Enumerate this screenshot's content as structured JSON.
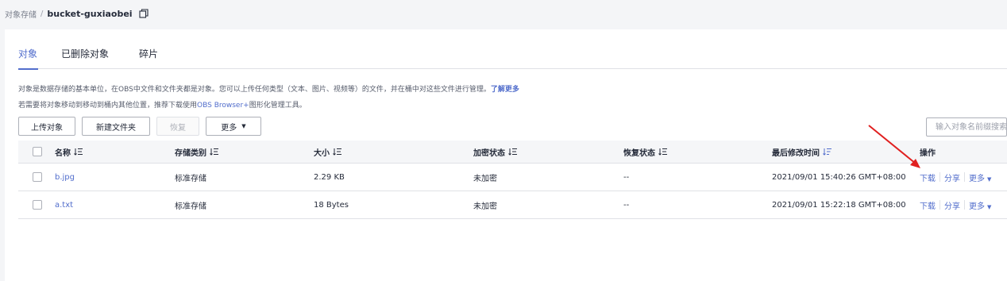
{
  "breadcrumb": {
    "parent": "对象存储",
    "separator": "/",
    "current": "bucket-guxiaobei",
    "copy_icon": "copy-icon"
  },
  "tabs": [
    {
      "label": "对象",
      "active": true
    },
    {
      "label": "已删除对象",
      "active": false
    },
    {
      "label": "碎片",
      "active": false
    }
  ],
  "description": {
    "line1": "对象是数据存储的基本单位，在OBS中文件和文件夹都是对象。您可以上传任何类型（文本、图片、视频等）的文件，并在桶中对这些文件进行管理。",
    "line1_link": "了解更多",
    "line2_prefix": "若需要将对象移动到移动到桶内其他位置，推荐下载使用",
    "line2_link": "OBS Browser+",
    "line2_suffix": "图形化管理工具。"
  },
  "toolbar": {
    "upload": "上传对象",
    "new_folder": "新建文件夹",
    "restore": "恢复",
    "more": "更多"
  },
  "search": {
    "placeholder": "输入对象名前缀搜索"
  },
  "table": {
    "columns": {
      "name": "名称",
      "storage": "存储类别",
      "size": "大小",
      "encryption": "加密状态",
      "restore": "恢复状态",
      "modified": "最后修改时间",
      "ops": "操作"
    },
    "rows": [
      {
        "name": "b.jpg",
        "storage": "标准存储",
        "size": "2.29 KB",
        "encryption": "未加密",
        "restore": "--",
        "modified": "2021/09/01 15:40:26 GMT+08:00"
      },
      {
        "name": "a.txt",
        "storage": "标准存储",
        "size": "18 Bytes",
        "encryption": "未加密",
        "restore": "--",
        "modified": "2021/09/01 15:22:18 GMT+08:00"
      }
    ],
    "ops": {
      "download": "下载",
      "share": "分享",
      "more": "更多"
    }
  },
  "colors": {
    "accent": "#526ecc",
    "annotation_arrow": "#e02020"
  }
}
